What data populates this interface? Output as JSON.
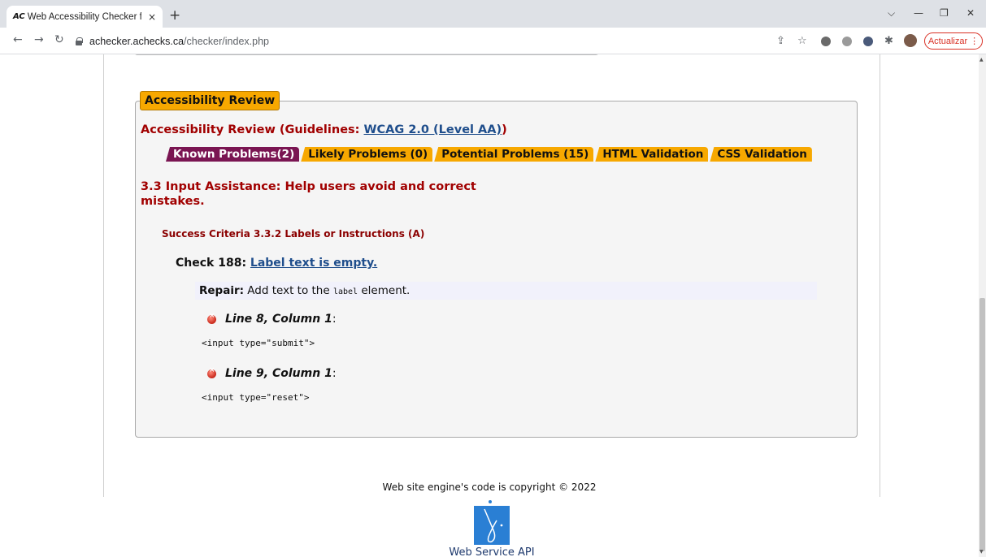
{
  "browser": {
    "tab_favicon": "AC",
    "tab_title": "Web Accessibility Checker for W",
    "tab_close": "×",
    "new_tab": "+",
    "url_host": "achecker.achecks.ca",
    "url_path": "/checker/index.php",
    "update_label": "Actualizar",
    "icons": [
      "back-icon",
      "forward-icon",
      "reload-icon",
      "lock-icon",
      "share-icon",
      "star-icon",
      "extension-icon",
      "profile-icon",
      "menu-icon"
    ]
  },
  "review": {
    "legend": "Accessibility Review",
    "guideline_prefix": "Accessibility Review (Guidelines: ",
    "guideline_link": "WCAG 2.0 (Level AA)",
    "guideline_suffix": ")",
    "tabs": [
      {
        "label": "Known Problems(2)",
        "active": true
      },
      {
        "label": "Likely Problems (0)",
        "active": false
      },
      {
        "label": "Potential Problems (15)",
        "active": false
      },
      {
        "label": "HTML Validation",
        "active": false
      },
      {
        "label": "CSS Validation",
        "active": false
      }
    ],
    "section_title": "3.3 Input Assistance: Help users avoid and correct mistakes.",
    "criteria": "Success Criteria 3.3.2 Labels or Instructions (A)",
    "check_prefix": "Check 188: ",
    "check_link": "Label text is empty.",
    "repair_label": "Repair:",
    "repair_text_before": " Add text to the ",
    "repair_code": "label",
    "repair_text_after": " element.",
    "problems": [
      {
        "location": "Line 8, Column 1",
        "suffix": ":",
        "snippet": "<input type=\"submit\">"
      },
      {
        "location": "Line 9, Column 1",
        "suffix": ":",
        "snippet": "<input type=\"reset\">"
      }
    ]
  },
  "footer": {
    "copyright": "Web site engine's code is copyright © 2022",
    "api_label": "Web Service API"
  },
  "colors": {
    "tab_orange": "#f7a800",
    "tab_active": "#7a1552",
    "heading_red": "#a10000",
    "link_blue": "#1f4e8c"
  }
}
